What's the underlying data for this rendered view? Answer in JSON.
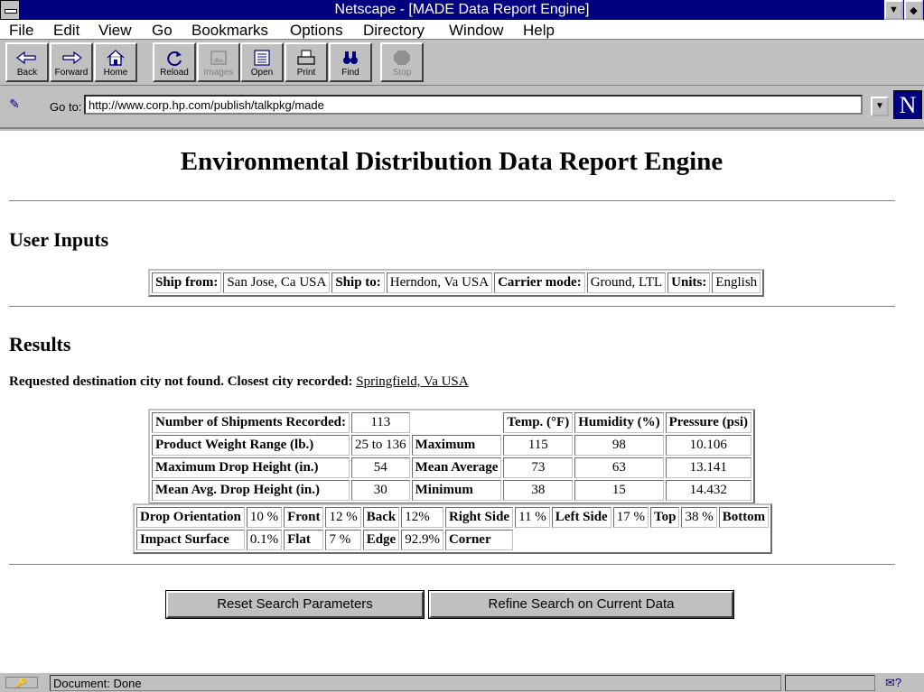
{
  "window": {
    "title": "Netscape - [MADE Data Report Engine]",
    "minimize": "▼",
    "maximize": "◆"
  },
  "menu": [
    "File",
    "Edit",
    "View",
    "Go",
    "Bookmarks",
    "Options",
    "Directory",
    "Window",
    "Help"
  ],
  "toolbar": {
    "back": "Back",
    "forward": "Forward",
    "home": "Home",
    "reload": "Reload",
    "images": "Images",
    "open": "Open",
    "print": "Print",
    "find": "Find",
    "stop": "Stop"
  },
  "location": {
    "label": "Go to:",
    "url": "http://www.corp.hp.com/publish/talkpkg/made",
    "logo": "N"
  },
  "page": {
    "title": "Environmental Distribution Data Report Engine",
    "user_inputs_heading": "User Inputs",
    "results_heading": "Results"
  },
  "inputs": {
    "ship_from_label": "Ship from:",
    "ship_from": "San Jose, Ca USA",
    "ship_to_label": "Ship to:",
    "ship_to": "Herndon, Va USA",
    "carrier_label": "Carrier mode:",
    "carrier": "Ground, LTL",
    "units_label": "Units:",
    "units": "English"
  },
  "notice": {
    "text": "Requested destination city not found. Closest city recorded:",
    "link": "Springfield, Va USA"
  },
  "stats": {
    "shipments_label": "Number of Shipments Recorded:",
    "shipments": "113",
    "weight_label": "Product Weight Range (lb.)",
    "weight": "25 to 136",
    "max_drop_label": "Maximum Drop Height (in.)",
    "max_drop": "54",
    "mean_drop_label": "Mean Avg. Drop Height (in.)",
    "mean_drop": "30",
    "headers": [
      "Temp. (°F)",
      "Humidity (%)",
      "Pressure (psi)"
    ],
    "rows": [
      {
        "label": "Maximum",
        "temp": "115",
        "humidity": "98",
        "pressure": "10.106"
      },
      {
        "label": "Mean Average",
        "temp": "73",
        "humidity": "63",
        "pressure": "13.141"
      },
      {
        "label": "Minimum",
        "temp": "38",
        "humidity": "15",
        "pressure": "14.432"
      }
    ]
  },
  "drops": {
    "orientation_label": "Drop Orientation",
    "orientation": [
      {
        "value": "10 %",
        "label": "Front"
      },
      {
        "value": "12 %",
        "label": "Back"
      },
      {
        "value": "12%",
        "label": "Right Side"
      },
      {
        "value": "11 %",
        "label": "Left Side"
      },
      {
        "value": "17 %",
        "label": "Top"
      },
      {
        "value": "38 %",
        "label": "Bottom"
      }
    ],
    "surface_label": "Impact Surface",
    "surface": [
      {
        "value": "0.1%",
        "label": "Flat"
      },
      {
        "value": "7 %",
        "label": "Edge"
      },
      {
        "value": "92.9%",
        "label": "Corner"
      }
    ]
  },
  "buttons": {
    "reset": "Reset Search Parameters",
    "refine": "Refine Search on Current Data"
  },
  "status": {
    "text": "Document: Done"
  }
}
